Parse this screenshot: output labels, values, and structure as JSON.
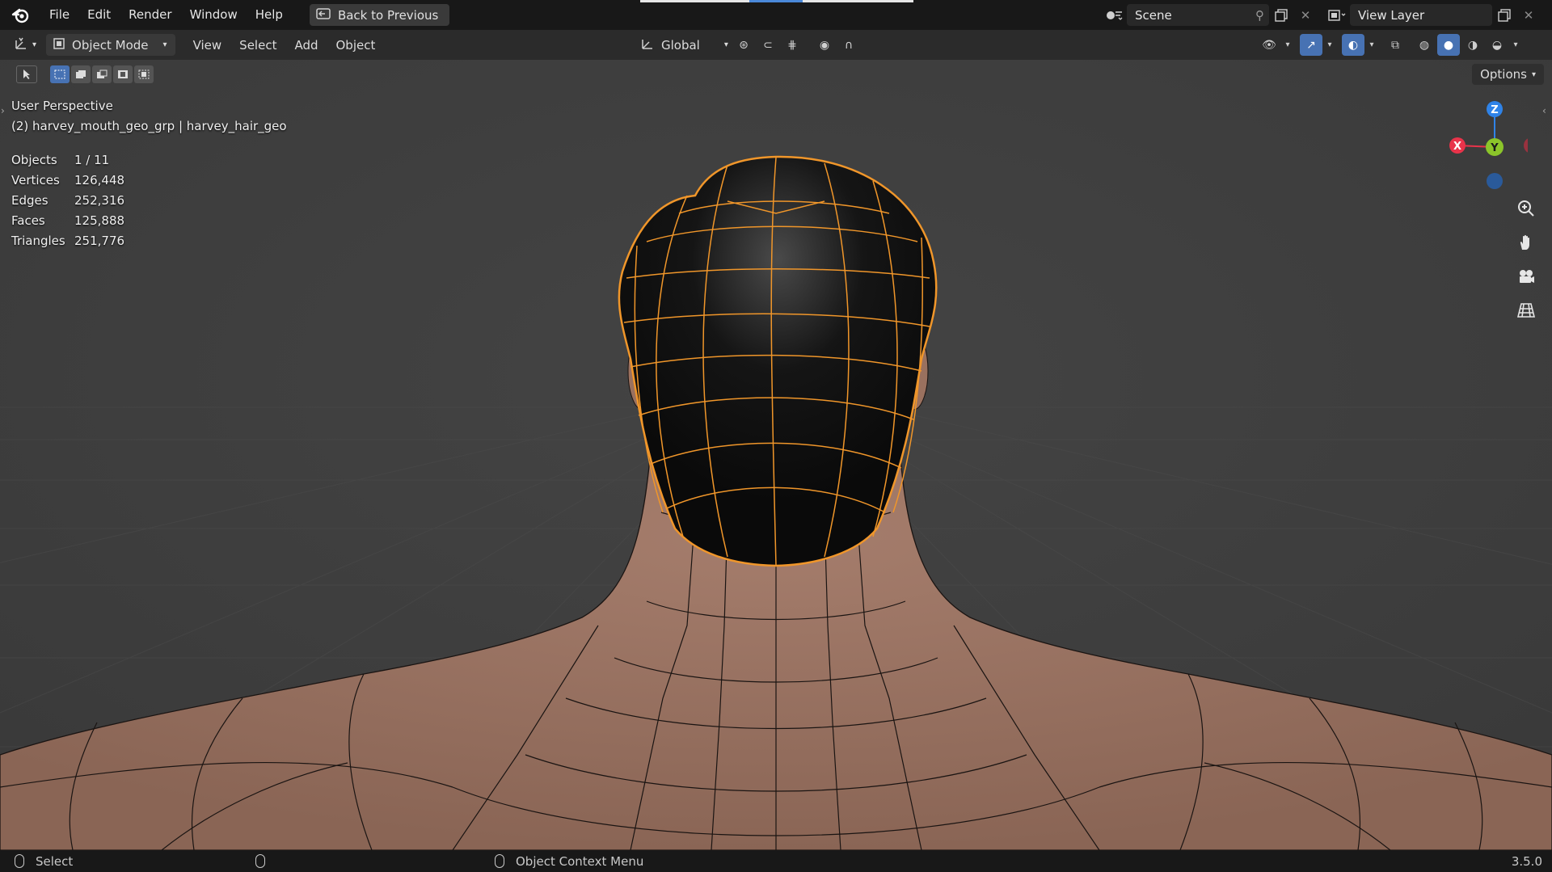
{
  "topbar": {
    "menu": [
      "File",
      "Edit",
      "Render",
      "Window",
      "Help"
    ],
    "back_button": "Back to Previous",
    "scene": "Scene",
    "view_layer": "View Layer"
  },
  "header": {
    "mode": "Object Mode",
    "menus": [
      "View",
      "Select",
      "Add",
      "Object"
    ],
    "orientation": "Global"
  },
  "toolrow": {
    "options": "Options"
  },
  "viewport": {
    "perspective": "User Perspective",
    "object_path": "(2) harvey_mouth_geo_grp | harvey_hair_geo",
    "stats": [
      {
        "label": "Objects",
        "value": "1 / 11"
      },
      {
        "label": "Vertices",
        "value": "126,448"
      },
      {
        "label": "Edges",
        "value": "252,316"
      },
      {
        "label": "Faces",
        "value": "125,888"
      },
      {
        "label": "Triangles",
        "value": "251,776"
      }
    ],
    "gizmo": {
      "x": "X",
      "y": "Y",
      "z": "Z"
    },
    "nav_icons": [
      "zoom-icon",
      "hand-icon",
      "camera-icon",
      "grid-icon"
    ]
  },
  "statusbar": {
    "select": "Select",
    "context_menu": "Object Context Menu",
    "version": "3.5.0"
  },
  "colors": {
    "selection_outline": "#f0962a",
    "active_tab": "#4a88d9",
    "x_axis": "#e8334a",
    "y_axis": "#8bc52a",
    "z_axis": "#2f83e8"
  }
}
